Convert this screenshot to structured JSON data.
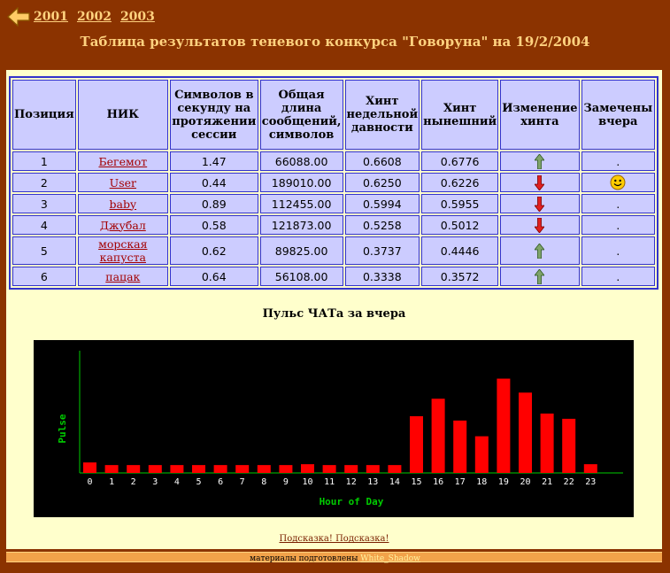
{
  "nav": {
    "back_icon": "left-arrow-icon",
    "years": [
      "2001",
      "2002",
      "2003"
    ]
  },
  "page_title": "Таблица результатов теневого конкурса \"Говоруна\" на 19/2/2004",
  "table": {
    "headers": [
      "Позиция",
      "НИК",
      "Символов в секунду на протяжении сессии",
      "Общая длина сообщений, символов",
      "Хинт недельной давности",
      "Хинт нынешний",
      "Изменение хинта",
      "Замечены вчера"
    ],
    "rows": [
      {
        "pos": "1",
        "nick": "Бегемот",
        "cps": "1.47",
        "length": "66088.00",
        "hint_week": "0.6608",
        "hint_now": "0.6776",
        "trend": "up",
        "seen": "."
      },
      {
        "pos": "2",
        "nick": "User",
        "cps": "0.44",
        "length": "189010.00",
        "hint_week": "0.6250",
        "hint_now": "0.6226",
        "trend": "down",
        "seen": "smiley"
      },
      {
        "pos": "3",
        "nick": "baby",
        "cps": "0.89",
        "length": "112455.00",
        "hint_week": "0.5994",
        "hint_now": "0.5955",
        "trend": "down",
        "seen": "."
      },
      {
        "pos": "4",
        "nick": "Джубал",
        "cps": "0.58",
        "length": "121873.00",
        "hint_week": "0.5258",
        "hint_now": "0.5012",
        "trend": "down",
        "seen": "."
      },
      {
        "pos": "5",
        "nick": "морская капуста",
        "cps": "0.62",
        "length": "89825.00",
        "hint_week": "0.3737",
        "hint_now": "0.4446",
        "trend": "up",
        "seen": "."
      },
      {
        "pos": "6",
        "nick": "пацак",
        "cps": "0.64",
        "length": "56108.00",
        "hint_week": "0.3338",
        "hint_now": "0.3572",
        "trend": "up",
        "seen": "."
      }
    ]
  },
  "chart_heading": "Пульс ЧАТа за вчера",
  "chart_data": {
    "type": "bar",
    "categories": [
      "0",
      "1",
      "2",
      "3",
      "4",
      "5",
      "6",
      "7",
      "8",
      "9",
      "10",
      "11",
      "12",
      "13",
      "14",
      "15",
      "16",
      "17",
      "18",
      "19",
      "20",
      "21",
      "22",
      "23"
    ],
    "values": [
      12,
      9,
      9,
      9,
      9,
      9,
      9,
      9,
      9,
      9,
      10,
      9,
      9,
      9,
      9,
      65,
      85,
      60,
      42,
      108,
      92,
      68,
      62,
      10
    ],
    "xlabel": "Hour of Day",
    "ylabel": "Pulse",
    "ylim": [
      0,
      140
    ],
    "colors": {
      "bar": "#ff0000",
      "background": "#000000",
      "axis": "#00cc00",
      "text": "#ffffff",
      "label": "#00cc00"
    }
  },
  "footer_link": "Подсказка! Подсказка!",
  "credit": {
    "text": "материалы подготовлены",
    "author": "White_Shadow"
  },
  "colors": {
    "page_bg": "#8b3300",
    "panel_bg": "#ffffcc",
    "cell_bg": "#ccccff",
    "border": "#3333cc",
    "link": "#a30000",
    "title": "#ffd27f"
  }
}
